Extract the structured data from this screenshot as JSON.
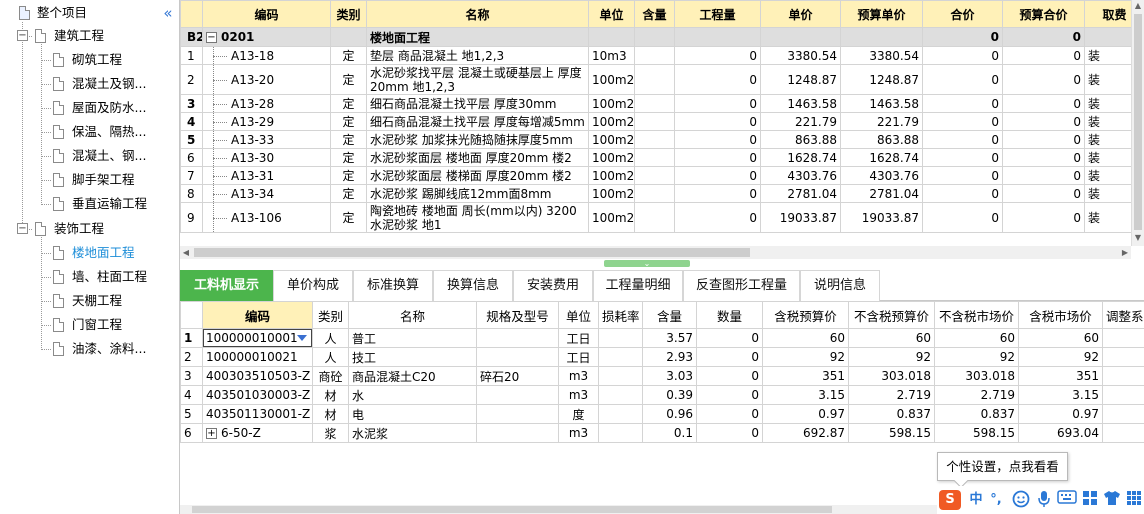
{
  "sidebar": {
    "collapse_icon": "double-chevron-left-icon",
    "nodes": [
      {
        "label": "整个项目"
      },
      {
        "label": "建筑工程"
      },
      {
        "label": "砌筑工程"
      },
      {
        "label": "混凝土及钢..."
      },
      {
        "label": "屋面及防水..."
      },
      {
        "label": "保温、隔热..."
      },
      {
        "label": "混凝土、钢..."
      },
      {
        "label": "脚手架工程"
      },
      {
        "label": "垂直运输工程"
      },
      {
        "label": "装饰工程"
      },
      {
        "label": "楼地面工程"
      },
      {
        "label": "墙、柱面工程"
      },
      {
        "label": "天棚工程"
      },
      {
        "label": "门窗工程"
      },
      {
        "label": "油漆、涂料..."
      }
    ]
  },
  "top_grid": {
    "headers": [
      "",
      "编码",
      "类别",
      "名称",
      "单位",
      "含量",
      "工程量",
      "单价",
      "预算单价",
      "合价",
      "预算合价",
      "取费"
    ],
    "group": {
      "rn": "B2",
      "code": "0201",
      "name": "楼地面工程",
      "hejia": "0",
      "ys_hejia": "0"
    },
    "rows": [
      {
        "rn": "1",
        "code": "A13-18",
        "type": "定",
        "name": "垫层 商品混凝土  地1,2,3",
        "unit": "10m3",
        "content": "",
        "qty": "0",
        "price": "3380.54",
        "budget_price": "3380.54",
        "total": "0",
        "budget_total": "0",
        "fee": "装"
      },
      {
        "rn": "2",
        "code": "A13-20",
        "type": "定",
        "name": "水泥砂浆找平层 混凝土或硬基层上 厚度20mm 地1,2,3",
        "unit": "100m2",
        "content": "",
        "qty": "0",
        "price": "1248.87",
        "budget_price": "1248.87",
        "total": "0",
        "budget_total": "0",
        "fee": "装"
      },
      {
        "rn": "3",
        "code": "A13-28",
        "type": "定",
        "name": "细石商品混凝土找平层 厚度30mm",
        "unit": "100m2",
        "content": "",
        "qty": "0",
        "price": "1463.58",
        "budget_price": "1463.58",
        "total": "0",
        "budget_total": "0",
        "fee": "装"
      },
      {
        "rn": "4",
        "code": "A13-29",
        "type": "定",
        "name": "细石商品混凝土找平层 厚度每增减5mm",
        "unit": "100m2",
        "content": "",
        "qty": "0",
        "price": "221.79",
        "budget_price": "221.79",
        "total": "0",
        "budget_total": "0",
        "fee": "装"
      },
      {
        "rn": "5",
        "code": "A13-33",
        "type": "定",
        "name": "水泥砂浆 加浆抹光随捣随抹厚度5mm",
        "unit": "100m2",
        "content": "",
        "qty": "0",
        "price": "863.88",
        "budget_price": "863.88",
        "total": "0",
        "budget_total": "0",
        "fee": "装"
      },
      {
        "rn": "6",
        "code": "A13-30",
        "type": "定",
        "name": "水泥砂浆面层 楼地面 厚度20mm 楼2",
        "unit": "100m2",
        "content": "",
        "qty": "0",
        "price": "1628.74",
        "budget_price": "1628.74",
        "total": "0",
        "budget_total": "0",
        "fee": "装"
      },
      {
        "rn": "7",
        "code": "A13-31",
        "type": "定",
        "name": "水泥砂浆面层 楼梯面 厚度20mm 楼2",
        "unit": "100m2",
        "content": "",
        "qty": "0",
        "price": "4303.76",
        "budget_price": "4303.76",
        "total": "0",
        "budget_total": "0",
        "fee": "装"
      },
      {
        "rn": "8",
        "code": "A13-34",
        "type": "定",
        "name": "水泥砂浆 踢脚线底12mm面8mm",
        "unit": "100m2",
        "content": "",
        "qty": "0",
        "price": "2781.04",
        "budget_price": "2781.04",
        "total": "0",
        "budget_total": "0",
        "fee": "装"
      },
      {
        "rn": "9",
        "code": "A13-106",
        "type": "定",
        "name": "陶瓷地砖 楼地面 周长(mm以内) 3200 水泥砂浆  地1",
        "unit": "100m2",
        "content": "",
        "qty": "0",
        "price": "19033.87",
        "budget_price": "19033.87",
        "total": "0",
        "budget_total": "0",
        "fee": "装"
      }
    ]
  },
  "tabs": [
    "工料机显示",
    "单价构成",
    "标准换算",
    "换算信息",
    "安装费用",
    "工程量明细",
    "反查图形工程量",
    "说明信息"
  ],
  "bottom_grid": {
    "headers": [
      "",
      "编码",
      "类别",
      "名称",
      "规格及型号",
      "单位",
      "损耗率",
      "含量",
      "数量",
      "含税预算价",
      "不含税预算价",
      "不含税市场价",
      "含税市场价",
      "调整系数"
    ],
    "rows": [
      {
        "rn": "1",
        "code": "100000010001",
        "type": "人",
        "name": "普工",
        "spec": "",
        "unit": "工日",
        "loss": "",
        "content": "3.57",
        "qty": "0",
        "p1": "60",
        "p2": "60",
        "p3": "60",
        "p4": "60"
      },
      {
        "rn": "2",
        "code": "100000010021",
        "type": "人",
        "name": "技工",
        "spec": "",
        "unit": "工日",
        "loss": "",
        "content": "2.93",
        "qty": "0",
        "p1": "92",
        "p2": "92",
        "p3": "92",
        "p4": "92"
      },
      {
        "rn": "3",
        "code": "400303510503-Z",
        "type": "商砼",
        "name": "商品混凝土C20",
        "spec": "碎石20",
        "unit": "m3",
        "loss": "",
        "content": "3.03",
        "qty": "0",
        "p1": "351",
        "p2": "303.018",
        "p3": "303.018",
        "p4": "351"
      },
      {
        "rn": "4",
        "code": "403501030003-Z",
        "type": "材",
        "name": "水",
        "spec": "",
        "unit": "m3",
        "loss": "",
        "content": "0.39",
        "qty": "0",
        "p1": "3.15",
        "p2": "2.719",
        "p3": "2.719",
        "p4": "3.15"
      },
      {
        "rn": "5",
        "code": "403501130001-Z",
        "type": "材",
        "name": "电",
        "spec": "",
        "unit": "度",
        "loss": "",
        "content": "0.96",
        "qty": "0",
        "p1": "0.97",
        "p2": "0.837",
        "p3": "0.837",
        "p4": "0.97"
      },
      {
        "rn": "6",
        "code": "6-50-Z",
        "type": "浆",
        "name": "水泥浆",
        "spec": "",
        "unit": "m3",
        "loss": "",
        "content": "0.1",
        "qty": "0",
        "p1": "692.87",
        "p2": "598.15",
        "p3": "598.15",
        "p4": "693.04"
      }
    ]
  },
  "tooltip": "个性设置，点我看看",
  "ime": {
    "logo": "S",
    "mode": "中",
    "punct": "°,"
  }
}
